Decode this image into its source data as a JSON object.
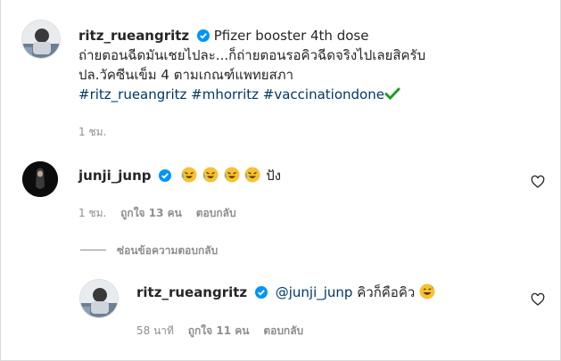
{
  "post": {
    "username": "ritz_rueangritz",
    "caption_line1": "Pfizer booster 4th dose",
    "caption_line2": "ถ่ายตอนฉีดมันเชยไปละ...ก็ถ่ายตอนรอคิวฉีดจริงไปเลยสิครับ",
    "caption_line3": "ปล.วัคซีนเข็ม 4 ตามเกณฑ์แพทยสภา",
    "hashtags": [
      "#ritz_rueangritz",
      "#mhorritz",
      "#vaccinationdone"
    ],
    "check_emoji": "check-mark",
    "time": "1 ชม."
  },
  "comment1": {
    "username": "junji_junp",
    "emoji_icons": [
      "rofl",
      "rofl",
      "rofl",
      "rofl"
    ],
    "text": "ปัง",
    "time": "1 ชม.",
    "likes": "ถูกใจ 13 คน",
    "reply": "ตอบกลับ",
    "hide_replies": "ซ่อนข้อความตอบกลับ"
  },
  "reply1": {
    "username": "ritz_rueangritz",
    "mention": "@junji_junp",
    "text": "คิวก็คือคิว",
    "emoji_icon": "grinning-sweat",
    "time": "58 นาที",
    "likes": "ถูกใจ 11 คน",
    "reply": "ตอบกลับ"
  },
  "colors": {
    "link": "#00376b",
    "verified": "#0095f6",
    "meta": "#8e8e8e",
    "check": "#1f9d1f"
  }
}
